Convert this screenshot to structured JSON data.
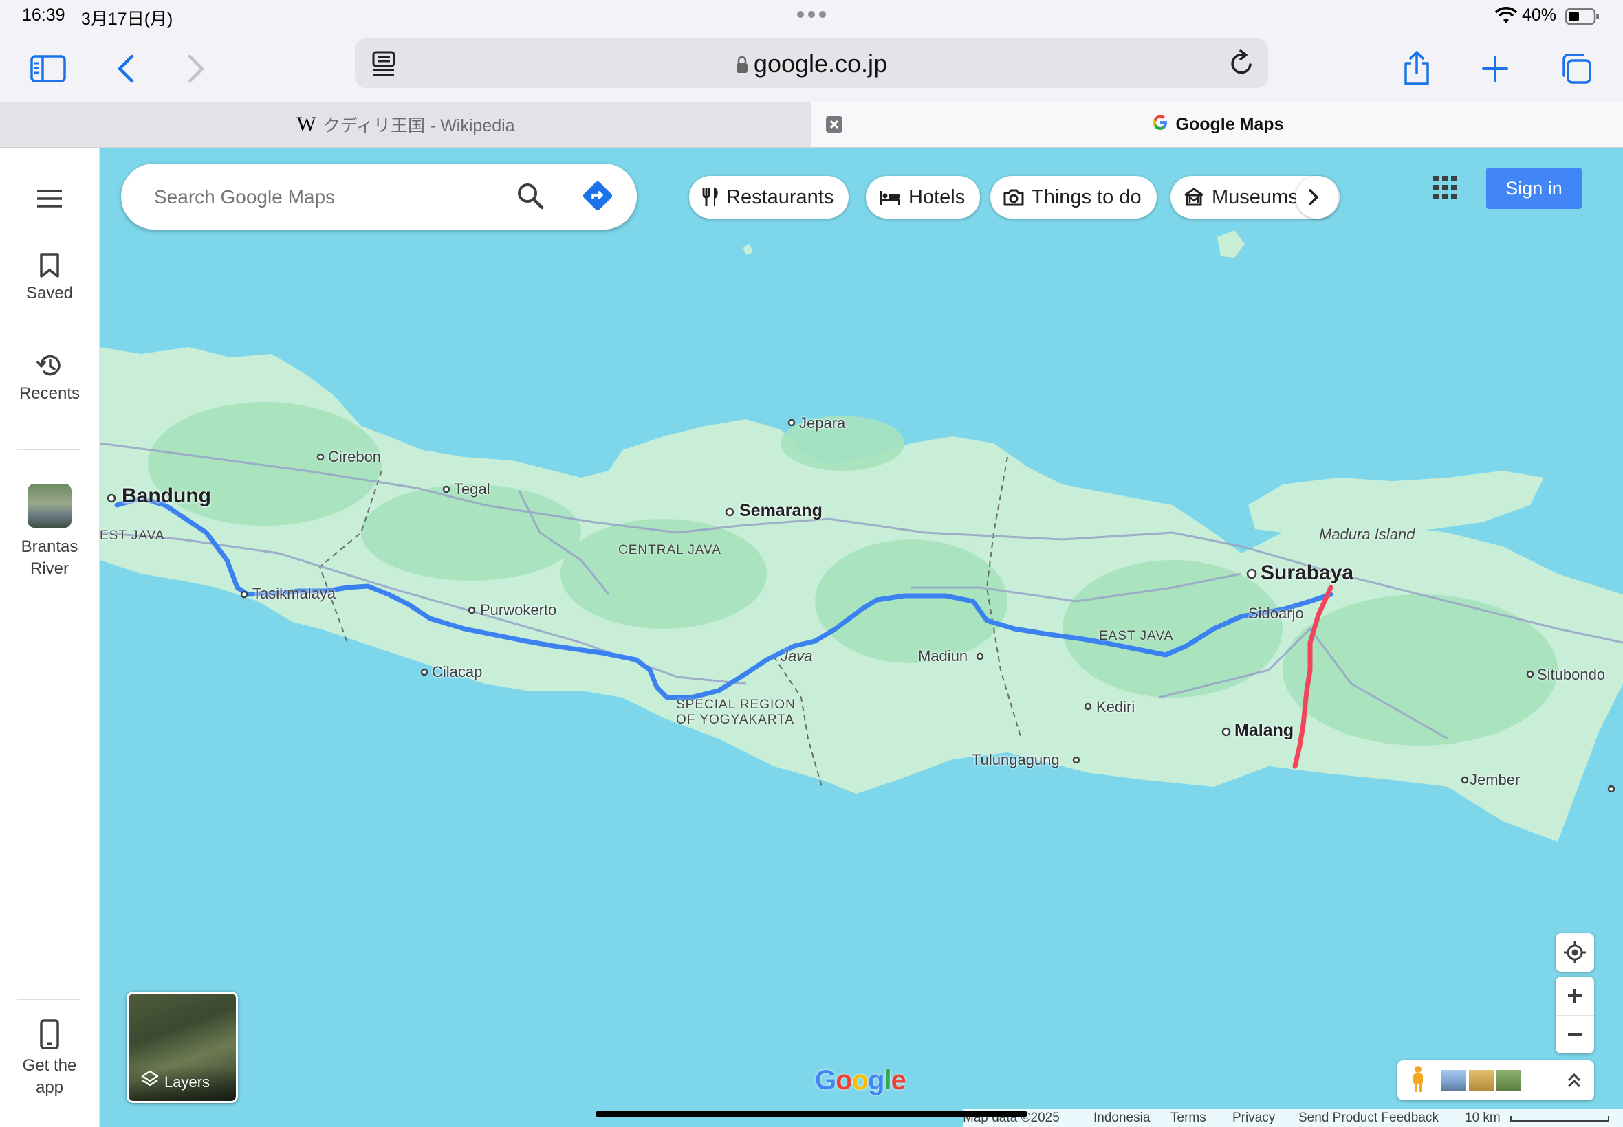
{
  "status_bar": {
    "time": "16:39",
    "date": "3月17日(月)",
    "battery": "40%"
  },
  "browser": {
    "url": "google.co.jp",
    "tabs": [
      {
        "title": "クディリ王国 - Wikipedia"
      },
      {
        "title": "Google Maps"
      }
    ]
  },
  "rail": {
    "saved": "Saved",
    "recents": "Recents",
    "recent_place": "Brantas River",
    "get_app": "Get the app"
  },
  "search": {
    "placeholder": "Search Google Maps"
  },
  "chips": [
    "Restaurants",
    "Hotels",
    "Things to do",
    "Museums"
  ],
  "signin": "Sign in",
  "map": {
    "cities": {
      "bandung": "Bandung",
      "cirebon": "Cirebon",
      "tegal": "Tegal",
      "jepara": "Jepara",
      "semarang": "Semarang",
      "tasikmalaya": "Tasikmalaya",
      "purwokerto": "Purwokerto",
      "cilacap": "Cilacap",
      "madiun": "Madiun",
      "kediri": "Kediri",
      "tulungagung": "Tulungagung",
      "surabaya": "Surabaya",
      "sidoarjo": "Sidoarjo",
      "malang": "Malang",
      "situbondo": "Situbondo",
      "jember": "Jember"
    },
    "regions": {
      "west_java": "EST JAVA",
      "central_java": "CENTRAL JAVA",
      "yogya_1": "SPECIAL REGION",
      "yogya_2": "OF YOGYAKARTA",
      "east_java": "EAST JAVA",
      "java": "Java",
      "madura": "Madura Island"
    },
    "layers_label": "Layers",
    "logo": "Google",
    "colors": {
      "route_main": "#3b82f0",
      "route_highlight": "#f0455a",
      "water": "#7dd6ea",
      "land": "#c8eed8"
    }
  },
  "footer": {
    "map_data": "Map data ©2025",
    "country": "Indonesia",
    "terms": "Terms",
    "privacy": "Privacy",
    "feedback": "Send Product Feedback",
    "scale": "10 km"
  }
}
